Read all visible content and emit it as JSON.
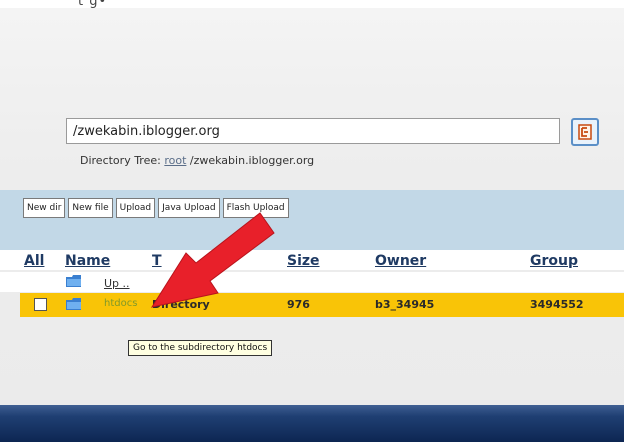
{
  "top_glyph": "t g•",
  "path": {
    "value": "/zwekabin.iblogger.org"
  },
  "directory_tree": {
    "label": "Directory Tree:",
    "root_link": "root",
    "path_text": "/zwekabin.iblogger.org"
  },
  "toolbar": {
    "buttons": [
      "New dir",
      "New file",
      "Upload",
      "Java Upload",
      "Flash Upload"
    ]
  },
  "table": {
    "headers": {
      "all": "All",
      "name": "Name",
      "type": "T",
      "size": "Size",
      "owner": "Owner",
      "group": "Group"
    },
    "up_label": "Up ..",
    "rows": [
      {
        "name": "htdocs",
        "type": "Directory",
        "size": "976",
        "owner": "b3_34945",
        "group": "3494552"
      }
    ]
  },
  "tooltip": "Go to the subdirectory htdocs",
  "colors": {
    "selected_row": "#f9c407",
    "toolbar_band": "#c2d8e7",
    "header_link": "#1f3a63",
    "arrow": "#e8202a",
    "footer": "#0d2652"
  },
  "icons": {
    "go_button": "go-icon",
    "folder": "folder-icon",
    "annotation": "red-arrow-icon"
  }
}
